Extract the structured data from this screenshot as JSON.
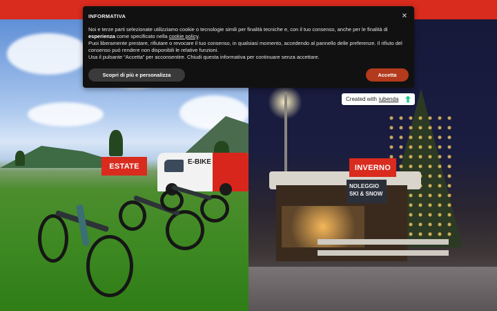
{
  "seasons": {
    "estate_label": "ESTATE",
    "inverno_label": "INVERNO"
  },
  "van": {
    "brand_text": "E-BIKE"
  },
  "hut": {
    "sign_line1": "NOLEGGIO",
    "sign_line2": "SKI & SNOW"
  },
  "iubenda": {
    "prefix": "Created with",
    "link": "iubenda"
  },
  "cookie_banner": {
    "title": "INFORMATIVA",
    "close_icon": "close-icon",
    "p1_before": "Noi e terze parti selezionate utilizziamo cookie o tecnologie simili per finalità tecniche e, con il tuo consenso, anche per le finalità di ",
    "p1_bold": "esperienza",
    "p1_middle": " come specificato nella ",
    "p1_link": "cookie policy",
    "p1_after": ".",
    "p2": "Puoi liberamente prestare, rifiutare o revocare il tuo consenso, in qualsiasi momento, accedendo al pannello delle preferenze. Il rifiuto del consenso può rendere non disponibili le relative funzioni.",
    "p3": "Usa il pulsante “Accetta” per acconsentire. Chiudi questa informativa per continuare senza accettare.",
    "more_button": "Scopri di più e personalizza",
    "accept_button": "Accetta"
  },
  "colors": {
    "brand_red": "#d92b1e",
    "banner_bg": "#111111",
    "accept_bg": "#b33a1c"
  }
}
